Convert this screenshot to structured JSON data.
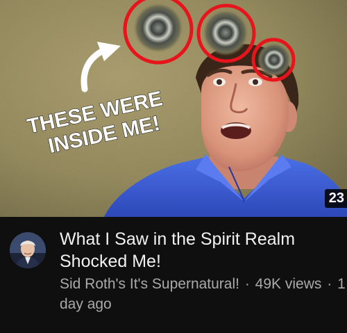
{
  "video": {
    "thumbnail_text_line1": "THESE WERE",
    "thumbnail_text_line2": "INSIDE ME!",
    "duration": "23",
    "title_line1": "What I Saw in the Spirit Realm",
    "title_line2": "Shocked Me!",
    "channel": "Sid Roth's It's Supernatural!",
    "separator": "·",
    "views": "49K views",
    "age_line1": "1",
    "age_line2": "day ago"
  },
  "colors": {
    "background": "#0f0f0f",
    "title": "#f1f1f1",
    "secondary_text": "#aaaaaa",
    "highlight_circle": "#e8141b",
    "shirt": "#3f63d8"
  }
}
